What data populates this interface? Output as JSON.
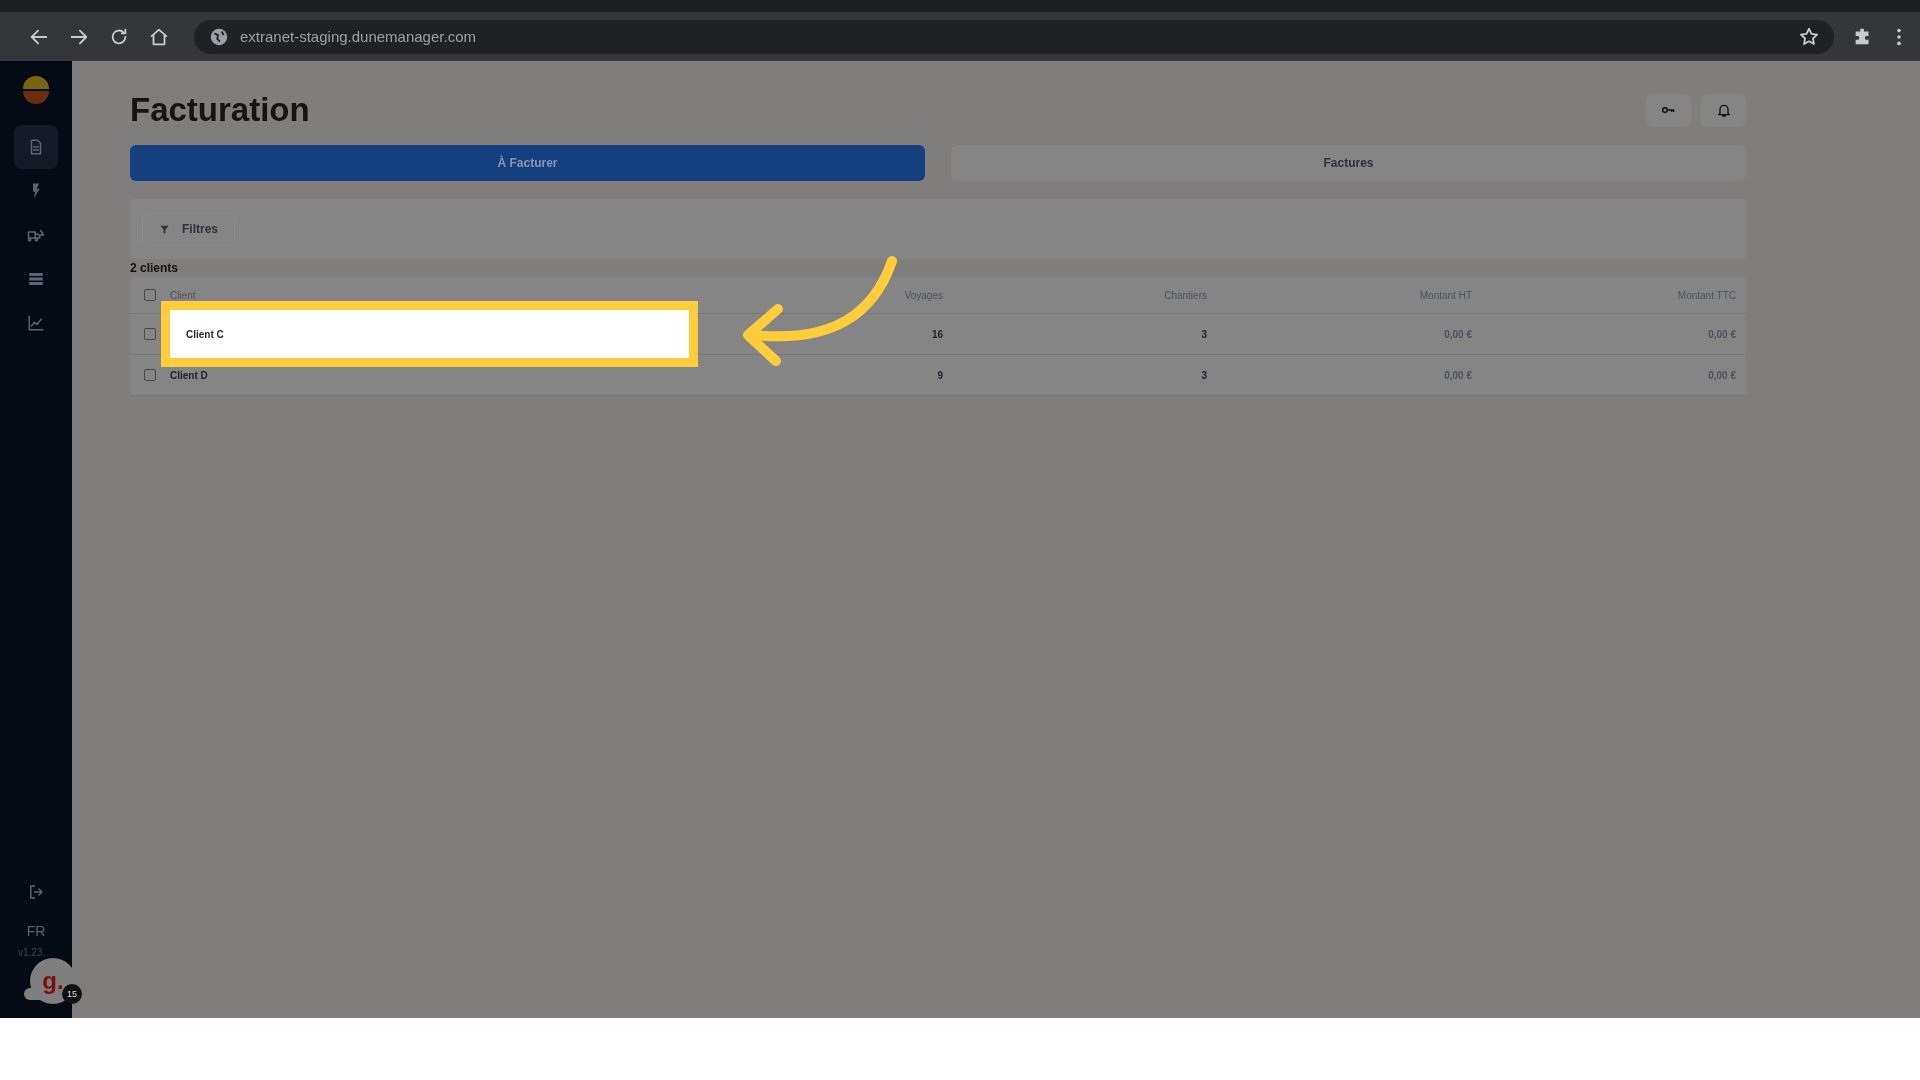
{
  "browser": {
    "url": "extranet-staging.dunemanager.com"
  },
  "sidebar": {
    "items": [
      {
        "selected": true
      },
      {
        "selected": false
      },
      {
        "selected": false
      },
      {
        "selected": false
      },
      {
        "selected": false
      }
    ],
    "language": "FR",
    "version": "v1.23.",
    "chat_badge": "15",
    "chat_letter": "g."
  },
  "page": {
    "title": "Facturation"
  },
  "tabs": [
    {
      "label": "À Facturer",
      "selected": true
    },
    {
      "label": "Factures",
      "selected": false
    }
  ],
  "filters": {
    "button": "Filtres"
  },
  "count": "2 clients",
  "table": {
    "all_checked": false,
    "columns": [
      "Client",
      "Voyages",
      "Chantiers",
      "Montant HT",
      "Montant TTC"
    ],
    "rows": [
      {
        "checked": false,
        "highlighted": true,
        "cells": [
          "Client C",
          "16",
          "3",
          "0,00 €",
          "0,00 €"
        ]
      },
      {
        "checked": false,
        "highlighted": false,
        "cells": [
          "Client D",
          "9",
          "3",
          "0,00 €",
          "0,00 €"
        ]
      }
    ]
  }
}
